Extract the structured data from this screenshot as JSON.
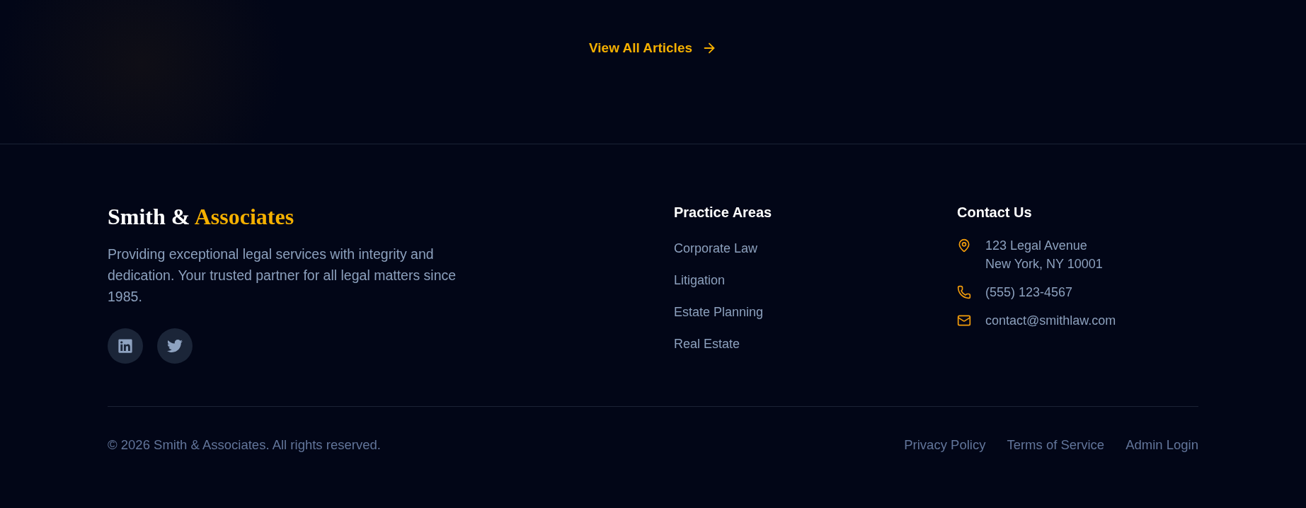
{
  "articles_link": {
    "label": "View All Articles"
  },
  "footer": {
    "brand": {
      "name": "Smith &",
      "accent": "Associates",
      "description": "Providing exceptional legal services with integrity and dedication. Your trusted partner for all legal matters since 1985.",
      "social_links": [
        {
          "kind": "linkedin"
        },
        {
          "kind": "twitter"
        }
      ]
    },
    "practice_areas": {
      "title": "Practice Areas",
      "links": [
        "Corporate Law",
        "Litigation",
        "Estate Planning",
        "Real Estate"
      ]
    },
    "contact": {
      "title": "Contact Us",
      "items": [
        {
          "kind": "address",
          "lines": [
            "123 Legal Avenue",
            "New York, NY 10001"
          ]
        },
        {
          "kind": "phone",
          "lines": [
            "(555) 123-4567"
          ]
        },
        {
          "kind": "email",
          "lines": [
            "contact@smithlaw.com"
          ]
        }
      ]
    },
    "bottom_bar": {
      "copyright": "© 2026 Smith & Associates. All rights reserved.",
      "links": [
        "Privacy Policy",
        "Terms of Service",
        "Admin Login"
      ]
    }
  }
}
